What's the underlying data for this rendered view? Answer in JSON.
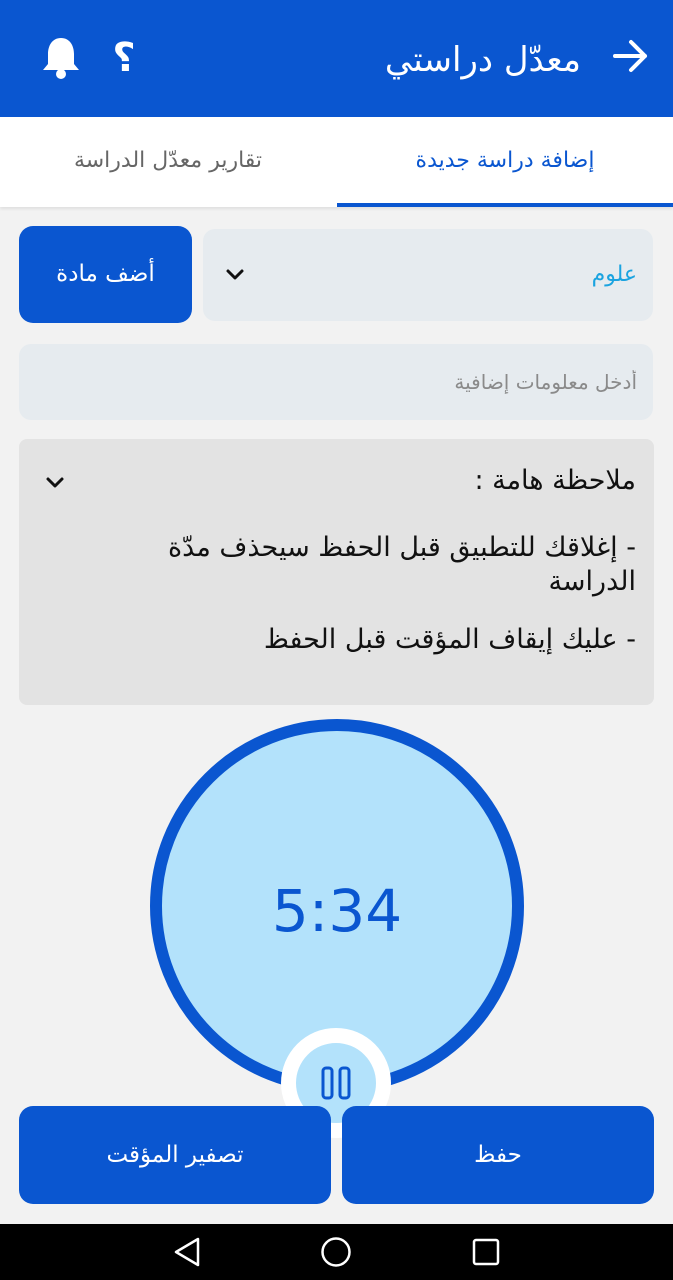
{
  "appbar": {
    "title": "معدّل دراستي",
    "help_symbol": "؟",
    "icons": [
      "arrow-right-icon",
      "help-icon",
      "bell-icon"
    ]
  },
  "tabs": [
    {
      "label": "إضافة دراسة جديدة",
      "active": true
    },
    {
      "label": "تقارير معدّل الدراسة",
      "active": false
    }
  ],
  "subject": {
    "selected": "علوم",
    "add_button": "أضف مادة"
  },
  "extra_info": {
    "placeholder": "أدخل معلومات إضافية",
    "value": ""
  },
  "note": {
    "title": "ملاحظة هامة :",
    "lines": [
      "- إغلاقك للتطبيق قبل الحفظ سيحذف مدّة الدراسة",
      "- عليك إيقاف المؤقت قبل الحفظ"
    ]
  },
  "timer": {
    "display": "5:34"
  },
  "buttons": {
    "reset": "تصفير المؤقت",
    "save": "حفظ"
  },
  "colors": {
    "primary": "#0a56d0",
    "timer_fill": "#b3e2fb",
    "selected_text": "#1aa3e0"
  }
}
